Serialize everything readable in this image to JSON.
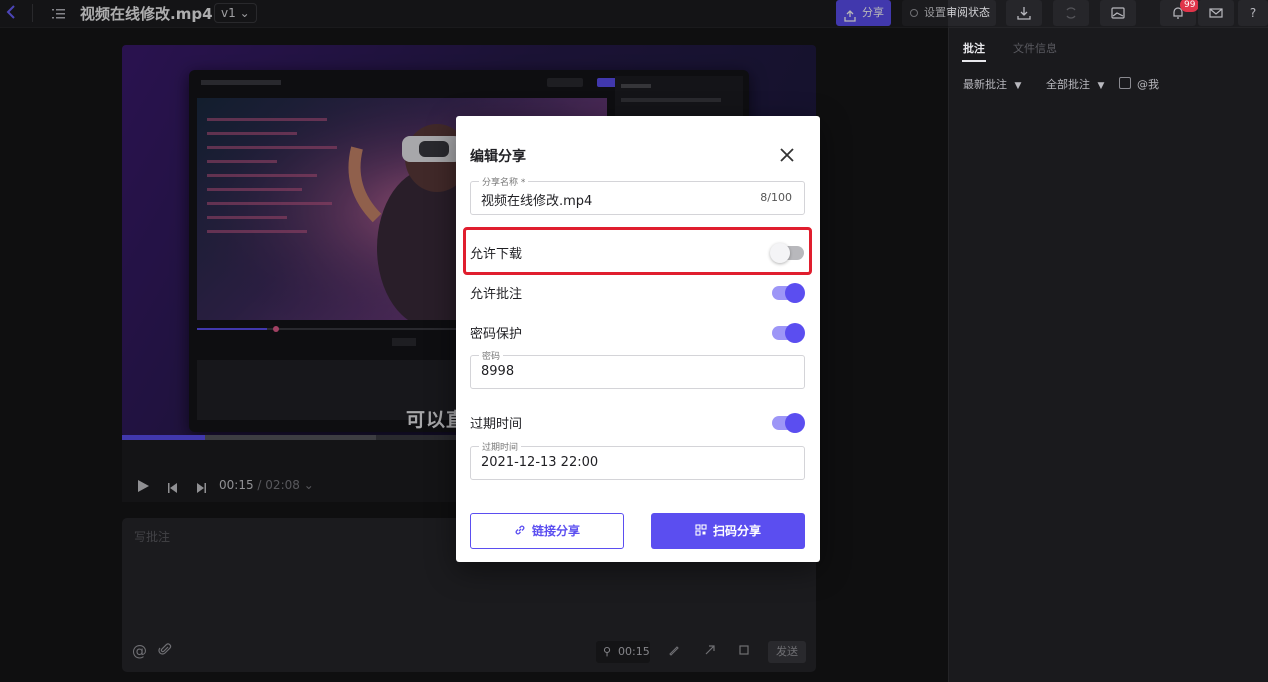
{
  "topbar": {
    "file_title": "视频在线修改.mp4",
    "version": "v1",
    "share_label": "分享",
    "review_status_label": "设置审阅状态",
    "notification_count": "99",
    "help_label": "?"
  },
  "player": {
    "subtitle": "可以直",
    "current_time": "00:15",
    "time_separator": "/",
    "duration": "02:08",
    "progress": 0.12
  },
  "comment": {
    "placeholder": "写批注",
    "timestamp": "00:15",
    "send_label": "发送"
  },
  "right_panel": {
    "tabs": [
      {
        "label": "批注",
        "active": true
      },
      {
        "label": "文件信息",
        "active": false
      }
    ],
    "filter_sort": "最新批注",
    "filter_scope": "全部批注",
    "mention_me": "@我"
  },
  "modal": {
    "title": "编辑分享",
    "share_name_label": "分享名称 *",
    "share_name_value": "视频在线修改.mp4",
    "share_name_count": "8/100",
    "allow_download": {
      "label": "允许下载",
      "enabled": false
    },
    "allow_comment": {
      "label": "允许批注",
      "enabled": true
    },
    "password_protect": {
      "label": "密码保护",
      "enabled": true
    },
    "password_label": "密码",
    "password_value": "8998",
    "expiry": {
      "label": "过期时间",
      "enabled": true
    },
    "expiry_field_label": "过期时间",
    "expiry_value": "2021-12-13 22:00",
    "link_share_label": "链接分享",
    "qr_share_label": "扫码分享"
  },
  "colors": {
    "accent": "#5b4ef0",
    "highlight": "#e01e2e",
    "badge": "#e0344a"
  }
}
